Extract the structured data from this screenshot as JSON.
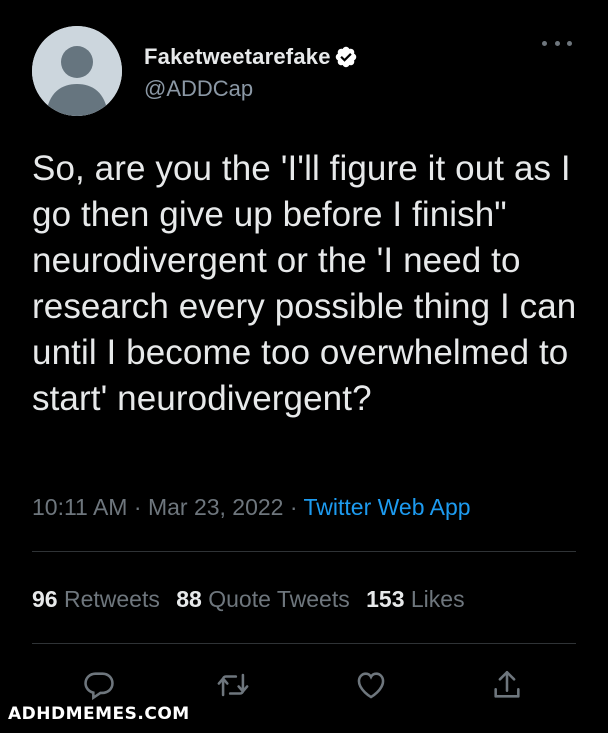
{
  "user": {
    "display_name": "Faketweetarefake",
    "handle": "@ADDCap",
    "avatar_icon": "default-avatar-icon",
    "verified_icon": "verified-badge-icon"
  },
  "tweet": {
    "text": "So, are you the 'I'll figure it out as I go then give up before I finish\" neurodivergent or the 'I need to research every possible thing I can until I become too overwhelmed to start' neurodivergent?",
    "time": "10:11 AM",
    "separator": "·",
    "date": "Mar 23, 2022",
    "source": "Twitter Web App"
  },
  "stats": {
    "retweets_count": "96",
    "retweets_label": "Retweets",
    "quote_tweets_count": "88",
    "quote_tweets_label": "Quote Tweets",
    "likes_count": "153",
    "likes_label": "Likes"
  },
  "actions": [
    "reply-icon",
    "retweet-icon",
    "like-icon",
    "share-icon"
  ],
  "watermark": "ADHDMEMES.COM",
  "colors": {
    "background": "#000000",
    "text": "#e7e9ea",
    "secondary": "#6e767d",
    "accent": "#1d9bf0",
    "divider": "#2f3336"
  }
}
